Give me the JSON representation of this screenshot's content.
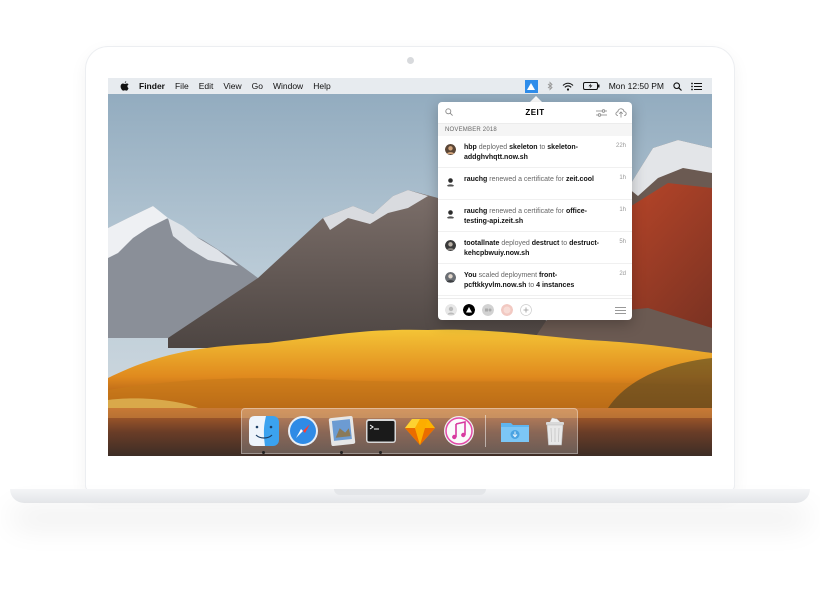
{
  "menubar": {
    "app_name": "Finder",
    "items": [
      "File",
      "Edit",
      "View",
      "Go",
      "Window",
      "Help"
    ],
    "clock": "Mon 12:50 PM"
  },
  "popover": {
    "title": "ZEIT",
    "month_header": "NOVEMBER 2018",
    "events": [
      {
        "user": "hbp",
        "action": " deployed ",
        "target": "skeleton",
        "connector": " to ",
        "url": "skeleton-addghvhqtt.now.sh",
        "time": "22h"
      },
      {
        "user": "rauchg",
        "action": " renewed a certificate for ",
        "target": "zeit.cool",
        "connector": "",
        "url": "",
        "time": "1h"
      },
      {
        "user": "rauchg",
        "action": " renewed a certificate for ",
        "target": "office-testing-api.zeit.sh",
        "connector": "",
        "url": "",
        "time": "1h"
      },
      {
        "user": "tootallnate",
        "action": " deployed ",
        "target": "destruct",
        "connector": " to ",
        "url": "destruct-kehcpbwuiy.now.sh",
        "time": "5h"
      },
      {
        "user": "You",
        "action": " scaled deployment ",
        "target": "front-pcftkkyvlm.now.sh",
        "connector": " to ",
        "url": "4 instances",
        "time": "2d"
      }
    ]
  },
  "dock": {
    "apps": [
      "finder-icon",
      "safari-icon",
      "preview-icon",
      "terminal-icon",
      "sketch-icon",
      "itunes-icon",
      "downloads-folder-icon",
      "trash-icon"
    ]
  },
  "colors": {
    "zeit_accent": "#2f8dea",
    "menubar_bg": "#eceef1"
  }
}
